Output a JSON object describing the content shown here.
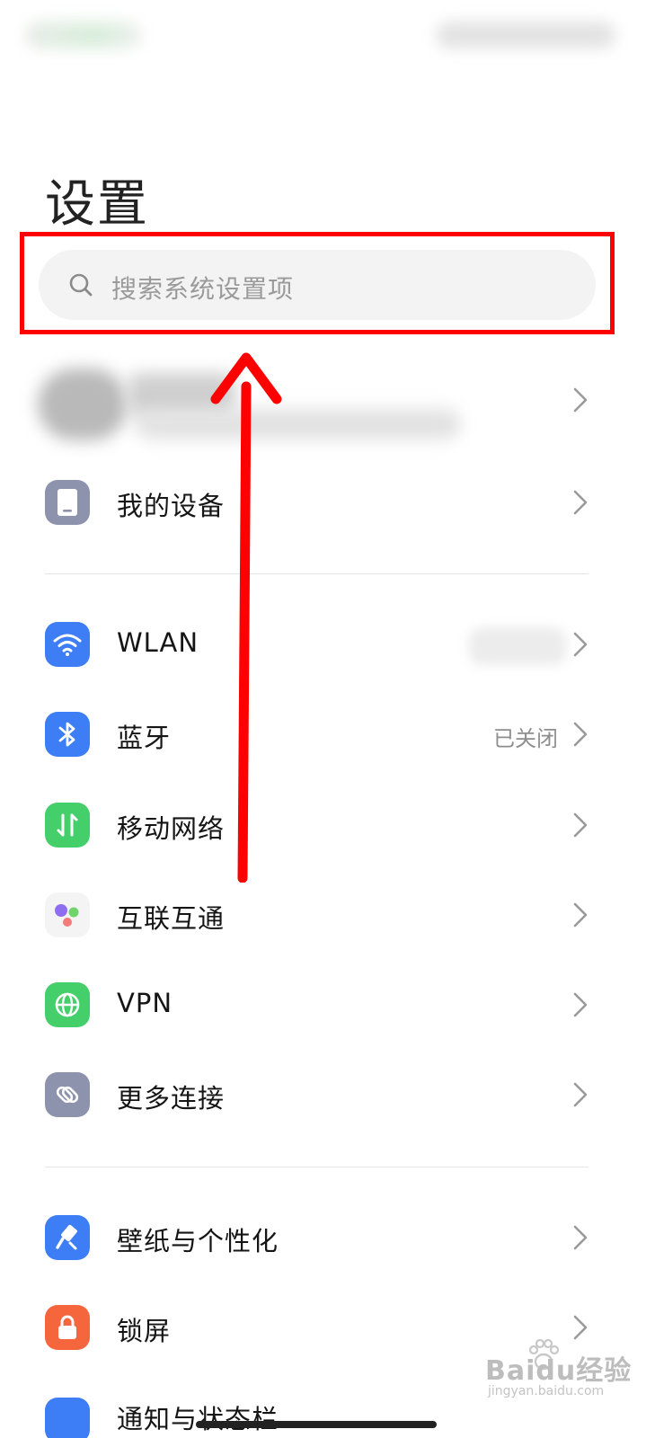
{
  "header": {
    "title": "设置"
  },
  "search": {
    "placeholder": "搜索系统设置项"
  },
  "items": [
    {
      "label": "我的设备",
      "value": "",
      "icon": "phone-icon",
      "color": "#8d92ad"
    },
    {
      "label": "WLAN",
      "value": "",
      "icon": "wifi-icon",
      "color": "#3d7df5"
    },
    {
      "label": "蓝牙",
      "value": "已关闭",
      "icon": "bluetooth-icon",
      "color": "#3d7df5"
    },
    {
      "label": "移动网络",
      "value": "",
      "icon": "mobile-data-icon",
      "color": "#44cf6b"
    },
    {
      "label": "互联互通",
      "value": "",
      "icon": "interconnect-icon",
      "color": "#f4f4f4"
    },
    {
      "label": "VPN",
      "value": "",
      "icon": "globe-icon",
      "color": "#44cf6b"
    },
    {
      "label": "更多连接",
      "value": "",
      "icon": "link-icon",
      "color": "#8d92ad"
    },
    {
      "label": "壁纸与个性化",
      "value": "",
      "icon": "brush-icon",
      "color": "#3d7df5"
    },
    {
      "label": "锁屏",
      "value": "",
      "icon": "lock-icon",
      "color": "#f5663d"
    }
  ],
  "partial_item": {
    "label": "通知与状态栏"
  },
  "watermark": {
    "brand": "Baidu经验",
    "url": "jingyan.baidu.com"
  },
  "annotation": {
    "frame_color": "#ff0000",
    "arrow_color": "#ff0000"
  }
}
